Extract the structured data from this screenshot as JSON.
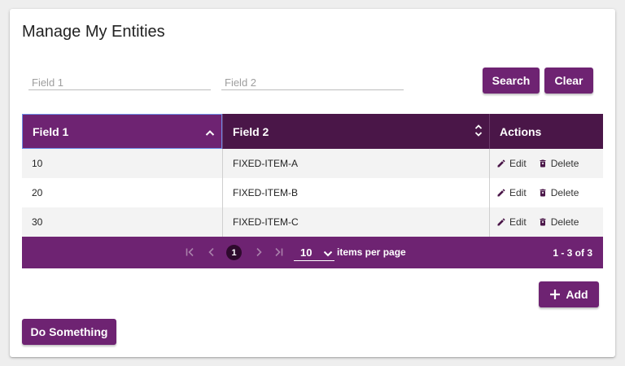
{
  "page": {
    "title": "Manage My Entities"
  },
  "filters": {
    "field1_placeholder": "Field 1",
    "field1_value": "",
    "field2_placeholder": "Field 2",
    "field2_value": "",
    "search_label": "Search",
    "clear_label": "Clear"
  },
  "table": {
    "columns": [
      "Field 1",
      "Field 2",
      "Actions"
    ],
    "rows": [
      {
        "field1": "10",
        "field2": "FIXED-ITEM-A",
        "edit": "Edit",
        "delete": "Delete"
      },
      {
        "field1": "20",
        "field2": "FIXED-ITEM-B",
        "edit": "Edit",
        "delete": "Delete"
      },
      {
        "field1": "30",
        "field2": "FIXED-ITEM-C",
        "edit": "Edit",
        "delete": "Delete"
      }
    ]
  },
  "paginator": {
    "current_page": "1",
    "page_size": "10",
    "items_per_page_label": "items per page",
    "range_label": "1 - 3 of 3"
  },
  "add_label": "Add",
  "do_something_label": "Do Something",
  "colors": {
    "primary": "#6e2372",
    "header_dark": "#4a1648",
    "page_background": "#eeeeee",
    "sorted_column_border": "#6f8fe8"
  },
  "icons": [
    "sort-asc-icon",
    "sort-both-icon",
    "edit-icon",
    "delete-icon",
    "first-page-icon",
    "prev-page-icon",
    "next-page-icon",
    "last-page-icon",
    "chevron-down-icon",
    "plus-icon"
  ]
}
